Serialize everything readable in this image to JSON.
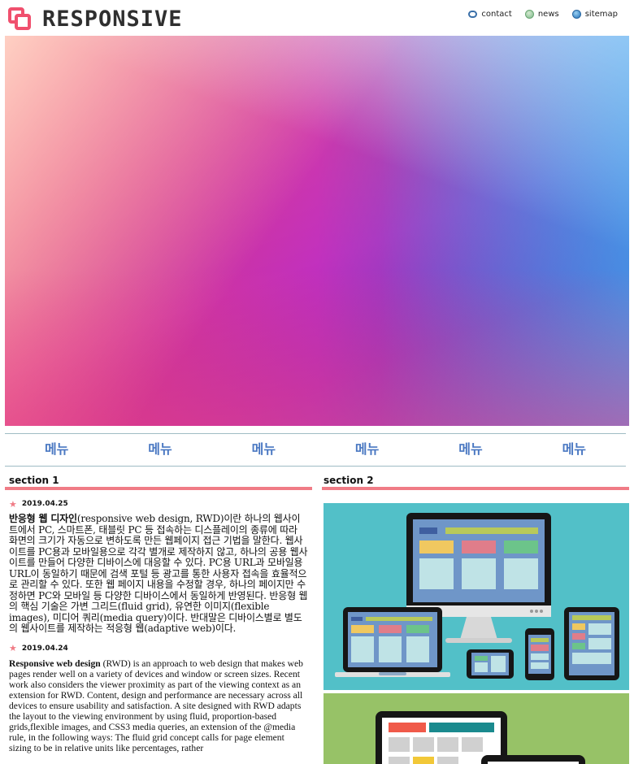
{
  "header": {
    "logo_text": "RESPONSIVE",
    "nav": [
      {
        "label": "contact",
        "icon": "contact-icon"
      },
      {
        "label": "news",
        "icon": "news-icon"
      },
      {
        "label": "sitemap",
        "icon": "sitemap-icon"
      }
    ]
  },
  "menu": [
    "메뉴",
    "메뉴",
    "메뉴",
    "메뉴",
    "메뉴",
    "메뉴"
  ],
  "section1": {
    "title": "section 1",
    "posts": [
      {
        "date": "2019.04.25",
        "lead": "반응형 웹 디자인",
        "text": "(responsive web design, RWD)이란 하나의 웹사이트에서 PC, 스마트폰, 태블릿 PC 등 접속하는 디스플레이의 종류에 따라 화면의 크기가 자동으로 변하도록 만든 웹페이지 접근 기법을 말한다. 웹사이트를 PC용과 모바일용으로 각각 별개로 제작하지 않고, 하나의 공용 웹사이트를 만들어 다양한 디바이스에 대응할 수 있다. PC용 URL과 모바일용 URL이 동일하기 때문에 검색 포털 등 광고를 통한 사용자 접속을 효율적으로 관리할 수 있다. 또한 웹 페이지 내용을 수정할 경우, 하나의 페이지만 수정하면 PC와 모바일 등 다양한 디바이스에서 동일하게 반영된다. 반응형 웹의 핵심 기술은 가변 그리드(fluid grid), 유연한 이미지(flexible images), 미디어 쿼리(media query)이다. 반대말은 디바이스별로 별도의 웹사이트를 제작하는 적응형 웹(adaptive web)이다."
      },
      {
        "date": "2019.04.24",
        "lead": "Responsive web design",
        "text": " (RWD) is an approach to web design that makes web pages render well on a variety of devices and window or screen sizes. Recent work also considers the viewer proximity as part of the viewing context as an extension for RWD. Content, design and performance are necessary across all devices to ensure usability and satisfaction. A site designed with RWD adapts the layout to the viewing environment by using fluid, proportion-based grids,flexible images, and CSS3 media queries, an extension of the @media rule, in the following ways: The fluid grid concept calls for page element sizing to be in relative units like percentages, rather"
      }
    ]
  },
  "section2": {
    "title": "section 2"
  }
}
